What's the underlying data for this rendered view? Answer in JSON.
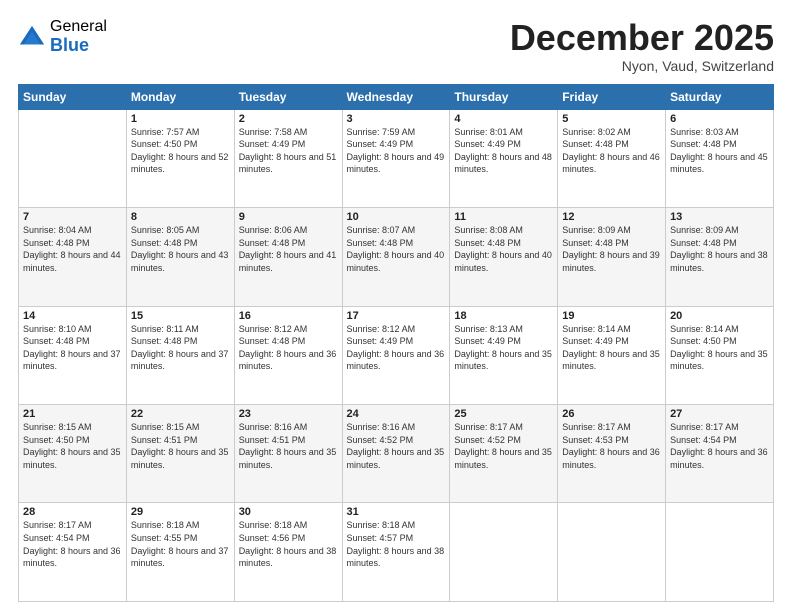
{
  "logo": {
    "general": "General",
    "blue": "Blue"
  },
  "title": "December 2025",
  "location": "Nyon, Vaud, Switzerland",
  "days_of_week": [
    "Sunday",
    "Monday",
    "Tuesday",
    "Wednesday",
    "Thursday",
    "Friday",
    "Saturday"
  ],
  "weeks": [
    [
      {
        "day": "",
        "sunrise": "",
        "sunset": "",
        "daylight": ""
      },
      {
        "day": "1",
        "sunrise": "Sunrise: 7:57 AM",
        "sunset": "Sunset: 4:50 PM",
        "daylight": "Daylight: 8 hours and 52 minutes."
      },
      {
        "day": "2",
        "sunrise": "Sunrise: 7:58 AM",
        "sunset": "Sunset: 4:49 PM",
        "daylight": "Daylight: 8 hours and 51 minutes."
      },
      {
        "day": "3",
        "sunrise": "Sunrise: 7:59 AM",
        "sunset": "Sunset: 4:49 PM",
        "daylight": "Daylight: 8 hours and 49 minutes."
      },
      {
        "day": "4",
        "sunrise": "Sunrise: 8:01 AM",
        "sunset": "Sunset: 4:49 PM",
        "daylight": "Daylight: 8 hours and 48 minutes."
      },
      {
        "day": "5",
        "sunrise": "Sunrise: 8:02 AM",
        "sunset": "Sunset: 4:48 PM",
        "daylight": "Daylight: 8 hours and 46 minutes."
      },
      {
        "day": "6",
        "sunrise": "Sunrise: 8:03 AM",
        "sunset": "Sunset: 4:48 PM",
        "daylight": "Daylight: 8 hours and 45 minutes."
      }
    ],
    [
      {
        "day": "7",
        "sunrise": "Sunrise: 8:04 AM",
        "sunset": "Sunset: 4:48 PM",
        "daylight": "Daylight: 8 hours and 44 minutes."
      },
      {
        "day": "8",
        "sunrise": "Sunrise: 8:05 AM",
        "sunset": "Sunset: 4:48 PM",
        "daylight": "Daylight: 8 hours and 43 minutes."
      },
      {
        "day": "9",
        "sunrise": "Sunrise: 8:06 AM",
        "sunset": "Sunset: 4:48 PM",
        "daylight": "Daylight: 8 hours and 41 minutes."
      },
      {
        "day": "10",
        "sunrise": "Sunrise: 8:07 AM",
        "sunset": "Sunset: 4:48 PM",
        "daylight": "Daylight: 8 hours and 40 minutes."
      },
      {
        "day": "11",
        "sunrise": "Sunrise: 8:08 AM",
        "sunset": "Sunset: 4:48 PM",
        "daylight": "Daylight: 8 hours and 40 minutes."
      },
      {
        "day": "12",
        "sunrise": "Sunrise: 8:09 AM",
        "sunset": "Sunset: 4:48 PM",
        "daylight": "Daylight: 8 hours and 39 minutes."
      },
      {
        "day": "13",
        "sunrise": "Sunrise: 8:09 AM",
        "sunset": "Sunset: 4:48 PM",
        "daylight": "Daylight: 8 hours and 38 minutes."
      }
    ],
    [
      {
        "day": "14",
        "sunrise": "Sunrise: 8:10 AM",
        "sunset": "Sunset: 4:48 PM",
        "daylight": "Daylight: 8 hours and 37 minutes."
      },
      {
        "day": "15",
        "sunrise": "Sunrise: 8:11 AM",
        "sunset": "Sunset: 4:48 PM",
        "daylight": "Daylight: 8 hours and 37 minutes."
      },
      {
        "day": "16",
        "sunrise": "Sunrise: 8:12 AM",
        "sunset": "Sunset: 4:48 PM",
        "daylight": "Daylight: 8 hours and 36 minutes."
      },
      {
        "day": "17",
        "sunrise": "Sunrise: 8:12 AM",
        "sunset": "Sunset: 4:49 PM",
        "daylight": "Daylight: 8 hours and 36 minutes."
      },
      {
        "day": "18",
        "sunrise": "Sunrise: 8:13 AM",
        "sunset": "Sunset: 4:49 PM",
        "daylight": "Daylight: 8 hours and 35 minutes."
      },
      {
        "day": "19",
        "sunrise": "Sunrise: 8:14 AM",
        "sunset": "Sunset: 4:49 PM",
        "daylight": "Daylight: 8 hours and 35 minutes."
      },
      {
        "day": "20",
        "sunrise": "Sunrise: 8:14 AM",
        "sunset": "Sunset: 4:50 PM",
        "daylight": "Daylight: 8 hours and 35 minutes."
      }
    ],
    [
      {
        "day": "21",
        "sunrise": "Sunrise: 8:15 AM",
        "sunset": "Sunset: 4:50 PM",
        "daylight": "Daylight: 8 hours and 35 minutes."
      },
      {
        "day": "22",
        "sunrise": "Sunrise: 8:15 AM",
        "sunset": "Sunset: 4:51 PM",
        "daylight": "Daylight: 8 hours and 35 minutes."
      },
      {
        "day": "23",
        "sunrise": "Sunrise: 8:16 AM",
        "sunset": "Sunset: 4:51 PM",
        "daylight": "Daylight: 8 hours and 35 minutes."
      },
      {
        "day": "24",
        "sunrise": "Sunrise: 8:16 AM",
        "sunset": "Sunset: 4:52 PM",
        "daylight": "Daylight: 8 hours and 35 minutes."
      },
      {
        "day": "25",
        "sunrise": "Sunrise: 8:17 AM",
        "sunset": "Sunset: 4:52 PM",
        "daylight": "Daylight: 8 hours and 35 minutes."
      },
      {
        "day": "26",
        "sunrise": "Sunrise: 8:17 AM",
        "sunset": "Sunset: 4:53 PM",
        "daylight": "Daylight: 8 hours and 36 minutes."
      },
      {
        "day": "27",
        "sunrise": "Sunrise: 8:17 AM",
        "sunset": "Sunset: 4:54 PM",
        "daylight": "Daylight: 8 hours and 36 minutes."
      }
    ],
    [
      {
        "day": "28",
        "sunrise": "Sunrise: 8:17 AM",
        "sunset": "Sunset: 4:54 PM",
        "daylight": "Daylight: 8 hours and 36 minutes."
      },
      {
        "day": "29",
        "sunrise": "Sunrise: 8:18 AM",
        "sunset": "Sunset: 4:55 PM",
        "daylight": "Daylight: 8 hours and 37 minutes."
      },
      {
        "day": "30",
        "sunrise": "Sunrise: 8:18 AM",
        "sunset": "Sunset: 4:56 PM",
        "daylight": "Daylight: 8 hours and 38 minutes."
      },
      {
        "day": "31",
        "sunrise": "Sunrise: 8:18 AM",
        "sunset": "Sunset: 4:57 PM",
        "daylight": "Daylight: 8 hours and 38 minutes."
      },
      {
        "day": "",
        "sunrise": "",
        "sunset": "",
        "daylight": ""
      },
      {
        "day": "",
        "sunrise": "",
        "sunset": "",
        "daylight": ""
      },
      {
        "day": "",
        "sunrise": "",
        "sunset": "",
        "daylight": ""
      }
    ]
  ]
}
